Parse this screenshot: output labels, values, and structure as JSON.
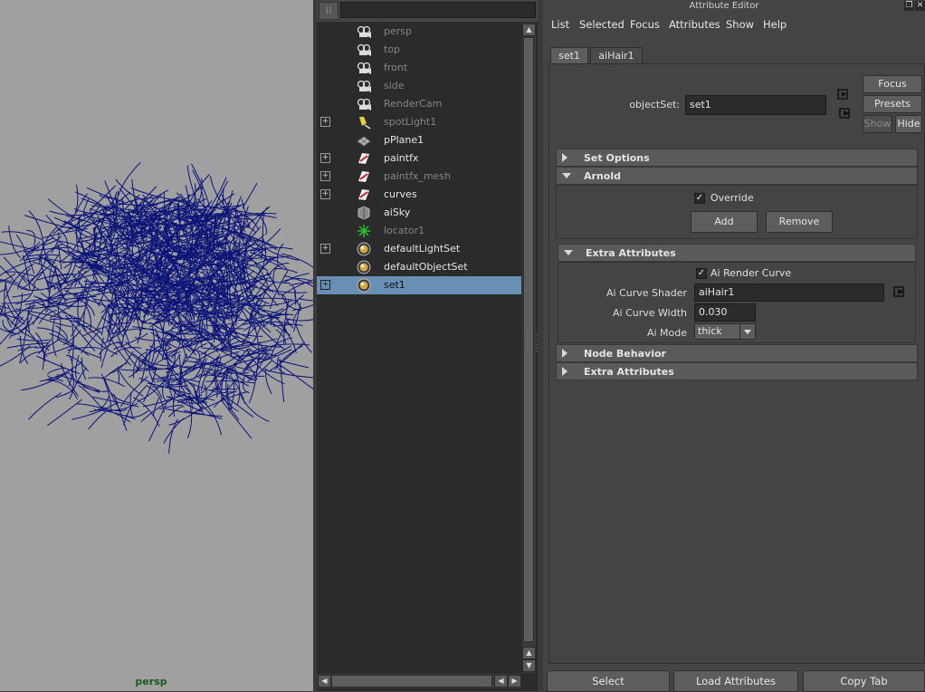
{
  "viewport": {
    "camera_label": "persp"
  },
  "outliner": {
    "search_value": "",
    "items": [
      {
        "label": "persp",
        "icon": "camera-icon",
        "dim": true,
        "expandable": false,
        "selected": false
      },
      {
        "label": "top",
        "icon": "camera-icon",
        "dim": true,
        "expandable": false,
        "selected": false
      },
      {
        "label": "front",
        "icon": "camera-icon",
        "dim": true,
        "expandable": false,
        "selected": false
      },
      {
        "label": "side",
        "icon": "camera-icon",
        "dim": true,
        "expandable": false,
        "selected": false
      },
      {
        "label": "RenderCam",
        "icon": "camera-icon",
        "dim": true,
        "expandable": false,
        "selected": false
      },
      {
        "label": "spotLight1",
        "icon": "spotlight-icon",
        "dim": true,
        "expandable": true,
        "selected": false
      },
      {
        "label": "pPlane1",
        "icon": "mesh-icon",
        "dim": false,
        "expandable": false,
        "selected": false
      },
      {
        "label": "paintfx",
        "icon": "paintfx-icon",
        "dim": false,
        "expandable": true,
        "selected": false
      },
      {
        "label": "paintfx_mesh",
        "icon": "paintfx-icon",
        "dim": true,
        "expandable": true,
        "selected": false
      },
      {
        "label": "curves",
        "icon": "paintfx-icon",
        "dim": false,
        "expandable": true,
        "selected": false
      },
      {
        "label": "aiSky",
        "icon": "sky-icon",
        "dim": false,
        "expandable": false,
        "selected": false
      },
      {
        "label": "locator1",
        "icon": "locator-icon",
        "dim": true,
        "expandable": false,
        "selected": false
      },
      {
        "label": "defaultLightSet",
        "icon": "set-icon",
        "dim": false,
        "expandable": true,
        "selected": false
      },
      {
        "label": "defaultObjectSet",
        "icon": "set-icon",
        "dim": false,
        "expandable": false,
        "selected": false
      },
      {
        "label": "set1",
        "icon": "set-icon",
        "dim": false,
        "expandable": true,
        "selected": true
      }
    ]
  },
  "attribute_editor": {
    "title": "Attribute Editor",
    "menu": [
      "List",
      "Selected",
      "Focus",
      "Attributes",
      "Show",
      "Help"
    ],
    "tabs": [
      {
        "label": "set1",
        "active": true
      },
      {
        "label": "aiHair1",
        "active": false
      }
    ],
    "object_set_label": "objectSet:",
    "object_set_value": "set1",
    "buttons": {
      "focus": "Focus",
      "presets": "Presets",
      "show": "Show",
      "hide": "Hide"
    },
    "sections": {
      "set_options": "Set Options",
      "arnold": "Arnold",
      "override_label": "Override",
      "override_checked": true,
      "add_button": "Add",
      "remove_button": "Remove",
      "extra_attributes_open": "Extra Attributes",
      "ai_render_curve_label": "Ai Render Curve",
      "ai_render_curve_checked": true,
      "ai_curve_shader_label": "Ai Curve Shader",
      "ai_curve_shader_value": "aiHair1",
      "ai_curve_width_label": "Ai Curve Width",
      "ai_curve_width_value": "0.030",
      "ai_mode_label": "Ai Mode",
      "ai_mode_value": "thick",
      "node_behavior": "Node Behavior",
      "extra_attributes_closed": "Extra Attributes"
    },
    "bottom_buttons": {
      "select": "Select",
      "load_attributes": "Load Attributes",
      "copy_tab": "Copy Tab"
    }
  }
}
